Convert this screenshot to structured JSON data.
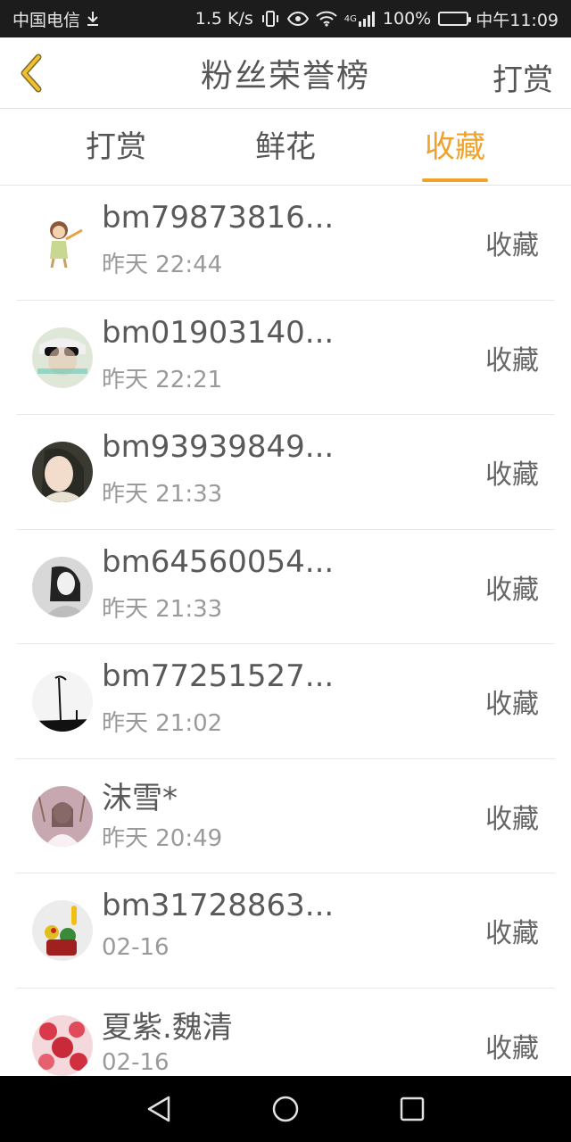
{
  "status_bar": {
    "carrier": "中国电信",
    "speed": "1.5 K/s",
    "network": "4G",
    "battery": "100%",
    "time": "中午11:09"
  },
  "header": {
    "title": "粉丝荣誉榜",
    "action": "打赏"
  },
  "tabs": [
    {
      "label": "打赏",
      "active": false
    },
    {
      "label": "鲜花",
      "active": false
    },
    {
      "label": "收藏",
      "active": true
    }
  ],
  "list": [
    {
      "name": "bm79873816...",
      "time": "昨天 22:44",
      "action": "收藏"
    },
    {
      "name": "bm01903140...",
      "time": "昨天 22:21",
      "action": "收藏"
    },
    {
      "name": "bm93939849...",
      "time": "昨天 21:33",
      "action": "收藏"
    },
    {
      "name": "bm64560054...",
      "time": "昨天 21:33",
      "action": "收藏"
    },
    {
      "name": "bm77251527...",
      "time": "昨天 21:02",
      "action": "收藏"
    },
    {
      "name": "沫雪*",
      "time": "昨天 20:49",
      "action": "收藏"
    },
    {
      "name": "bm31728863...",
      "time": "02-16",
      "action": "收藏"
    },
    {
      "name": "夏紫.魏清",
      "time": "02-16",
      "action": "收藏"
    }
  ],
  "colors": {
    "accent": "#f0a22a",
    "text": "#555555",
    "subtext": "#9a9a9a"
  }
}
